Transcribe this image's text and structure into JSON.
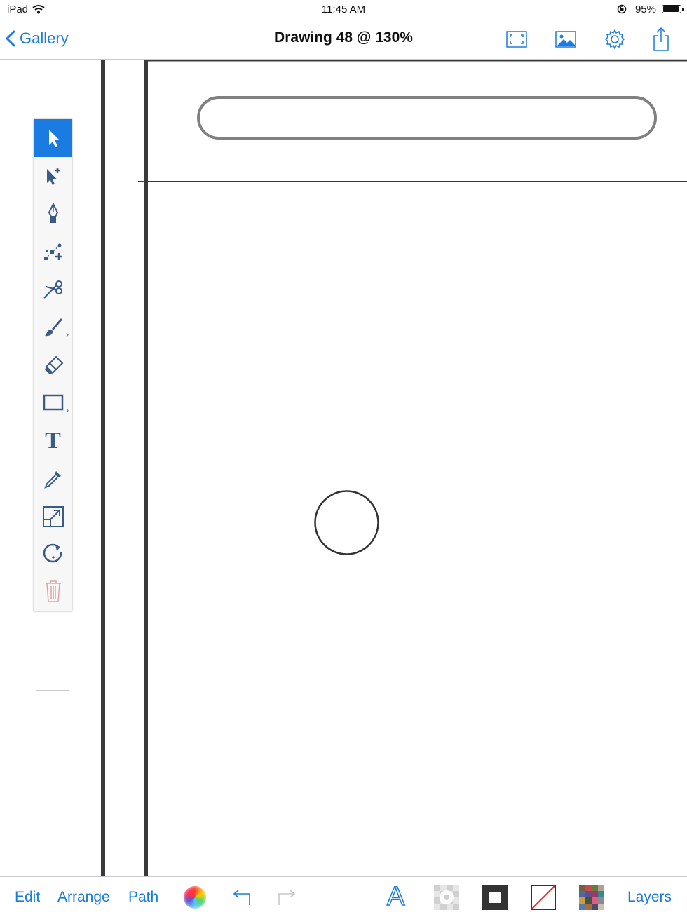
{
  "status_bar": {
    "carrier": "iPad",
    "time": "11:45 AM",
    "battery_percent": "95%",
    "battery_level": 0.95
  },
  "nav": {
    "back_label": "Gallery",
    "title": "Drawing 48 @ 130%",
    "icons": [
      "fullscreen-icon",
      "image-icon",
      "settings-gear-icon",
      "share-icon"
    ]
  },
  "palette": {
    "tools": [
      "select-arrow-icon",
      "add-point-icon",
      "pen-nib-icon",
      "node-path-icon",
      "scissors-icon",
      "brush-icon",
      "eraser-icon",
      "rectangle-icon",
      "text-tool-icon",
      "eyedropper-icon",
      "scale-icon",
      "rotate-icon",
      "trash-icon"
    ],
    "text_tool_glyph": "T"
  },
  "toolbar": {
    "edit": "Edit",
    "arrange": "Arrange",
    "path": "Path",
    "layers": "Layers",
    "font_glyph": "A"
  },
  "colors": {
    "accent": "#1a7be0",
    "tool_icon": "#3a5a88",
    "canvas_line": "#333333",
    "trash": "#e8a0a0"
  }
}
